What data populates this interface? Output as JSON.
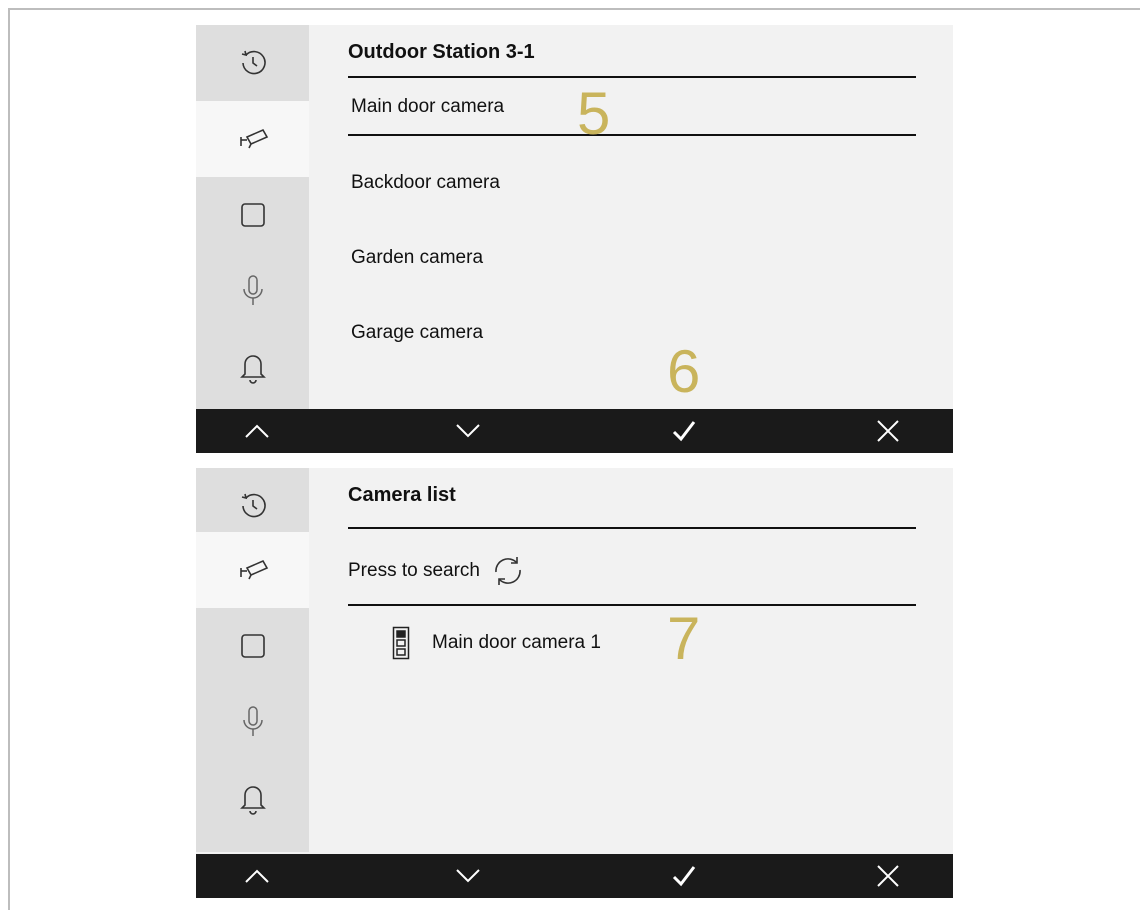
{
  "sidebar_icons": [
    "history-icon",
    "camera-icon",
    "square-icon",
    "microphone-icon",
    "bell-icon"
  ],
  "screen1": {
    "title": "Outdoor Station 3-1",
    "items": [
      "Main door camera",
      "Backdoor camera",
      "Garden camera",
      "Garage camera"
    ],
    "markers": [
      "5",
      "6"
    ]
  },
  "screen2": {
    "title": "Camera list",
    "search_label": "Press to search",
    "camera_item": "Main door camera 1",
    "markers": [
      "7"
    ]
  },
  "bottom_bar": [
    "up-arrow-icon",
    "down-arrow-icon",
    "check-icon",
    "close-icon"
  ],
  "colors": {
    "sidebar": "#dedede",
    "content": "#f2f2f2",
    "bar": "#1a1a1a",
    "marker": "#c9b45c"
  }
}
